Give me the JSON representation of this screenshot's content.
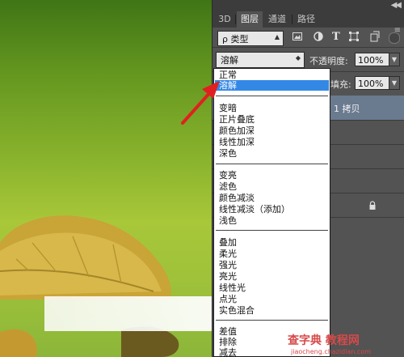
{
  "panel": {
    "tabs": [
      {
        "label": "3D",
        "active": false
      },
      {
        "label": "图层",
        "active": true
      },
      {
        "label": "通道",
        "active": false
      },
      {
        "label": "路径",
        "active": false
      }
    ],
    "filter": {
      "kind_label": "ρ 类型"
    },
    "blend_mode": {
      "current": "溶解"
    },
    "opacity": {
      "label": "不透明度:",
      "value": "100%"
    },
    "fill": {
      "label": "填充:",
      "value": "100%"
    },
    "selected_layer": {
      "name": "1 拷贝"
    }
  },
  "blend_menu": {
    "groups": [
      [
        "正常",
        "溶解"
      ],
      [
        "变暗",
        "正片叠底",
        "颜色加深",
        "线性加深",
        "深色"
      ],
      [
        "变亮",
        "滤色",
        "颜色减淡",
        "线性减淡（添加）",
        "浅色"
      ],
      [
        "叠加",
        "柔光",
        "强光",
        "亮光",
        "线性光",
        "点光",
        "实色混合"
      ],
      [
        "差值",
        "排除",
        "减去"
      ]
    ],
    "selected": "溶解"
  },
  "watermark": {
    "brand": "查字典 教程网",
    "url": "jiaocheng.chazidian.com"
  },
  "colors": {
    "menu_highlight": "#3388e6",
    "panel_bg": "#535353",
    "arrow": "#e02020"
  }
}
